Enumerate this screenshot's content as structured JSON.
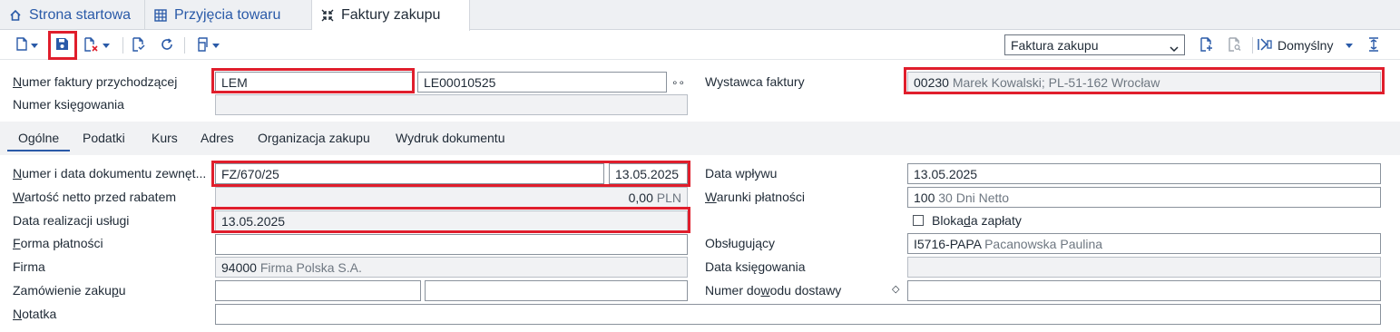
{
  "tabs": [
    {
      "label": "Strona startowa",
      "icon": "home-icon"
    },
    {
      "label": "Przyjęcia towaru",
      "icon": "grid-icon"
    },
    {
      "label": "Faktury zakupu",
      "icon": "collapse-icon"
    }
  ],
  "toolbar": {
    "view_select": "Faktura zakupu",
    "layout_label": "Domyślny",
    "icons": [
      "new-document-icon",
      "save-icon",
      "delete-document-icon",
      "check-document-icon",
      "refresh-icon",
      "print-icon",
      "add-document-icon",
      "search-document-icon",
      "layout-icon",
      "align-icon"
    ]
  },
  "header": {
    "invoice_number_label": "Numer faktury przychodzącej",
    "invoice_prefix": "LEM",
    "invoice_number": "LE00010525",
    "booking_number_label": "Numer księgowania",
    "booking_number": "",
    "issuer_label": "Wystawca faktury",
    "issuer_code": "00230",
    "issuer_desc": "Marek Kowalski; PL-51-162 Wrocław"
  },
  "subtabs": [
    "Ogólne",
    "Podatki",
    "Kurs",
    "Adres",
    "Organizacja zakupu",
    "Wydruk dokumentu"
  ],
  "general": {
    "ext_doc_label": "Numer i data dokumentu zewnęt...",
    "ext_doc_number": "FZ/670/25",
    "ext_doc_date": "13.05.2025",
    "net_value_label": "Wartość netto przed rabatem",
    "net_value": "0,00",
    "net_currency": "PLN",
    "service_date_label": "Data realizacji usługi",
    "service_date": "13.05.2025",
    "payment_form_label": "Forma płatności",
    "payment_form": "",
    "company_label": "Firma",
    "company_code": "94000",
    "company_desc": "Firma Polska S.A.",
    "purchase_order_label": "Zamówienie zakupu",
    "purchase_order_1": "",
    "purchase_order_2": "",
    "note_label": "Notatka",
    "note": "",
    "receipt_date_label": "Data wpływu",
    "receipt_date": "13.05.2025",
    "payment_terms_label": "Warunki płatności",
    "payment_terms_code": "100",
    "payment_terms_desc": "30 Dni Netto",
    "payment_block_label": "Blokada zapłaty",
    "handler_label": "Obsługujący",
    "handler_code": "I5716-PAPA",
    "handler_desc": "Pacanowska Paulina",
    "booking_date_label": "Data księgowania",
    "booking_date": "",
    "delivery_proof_label": "Numer dowodu dostawy",
    "delivery_proof": ""
  },
  "colors": {
    "accent": "#2a5aa8",
    "highlight": "#e01e2c"
  }
}
